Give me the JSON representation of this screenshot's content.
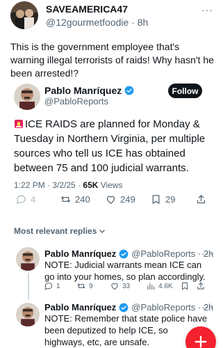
{
  "top_post": {
    "display_name": "SAVEAMERICA47",
    "handle_time": "@12gourmetfoodie · 8h",
    "more": "···",
    "text": "This is the government employee that's warning illegal terrorists of raids! Why hasn't he been arrested!?"
  },
  "quoted_post": {
    "display_name": "Pablo Manríquez",
    "handle": "@PabloReports",
    "follow_label": "Follow",
    "text": "ICE RAIDS are planned for Monday & Tuesday in Northern Virginia, per multiple sources who tell us ICE has obtained between 75 and 100 judicial warrants.",
    "time": "1:22 PM · 3/2/25 · ",
    "views_count": "65K",
    "views_label": " Views",
    "stats": {
      "replies": "4",
      "reposts": "240",
      "likes": "249",
      "bookmarks": "29"
    }
  },
  "replies_header": "Most relevant replies",
  "replies": [
    {
      "display_name": "Pablo Manríquez",
      "handle_time": "@PabloReports · 2h",
      "more": "···",
      "text": "NOTE: Judicial warrants mean ICE can go into your homes, so plan accordingly.",
      "stats": {
        "replies": "1",
        "reposts": "9",
        "likes": "33",
        "views": "4.6K"
      }
    },
    {
      "display_name": "Pablo Manríquez",
      "handle_time": "@PabloReports · 2h",
      "more": "···",
      "text": "NOTE: Remember that state police have been deputized to help ICE, so highways, etc, are unsafe."
    }
  ],
  "colors": {
    "accent": "#1d9bf0",
    "fab": "#f4212e",
    "text": "#0f1419",
    "muted": "#536471"
  }
}
